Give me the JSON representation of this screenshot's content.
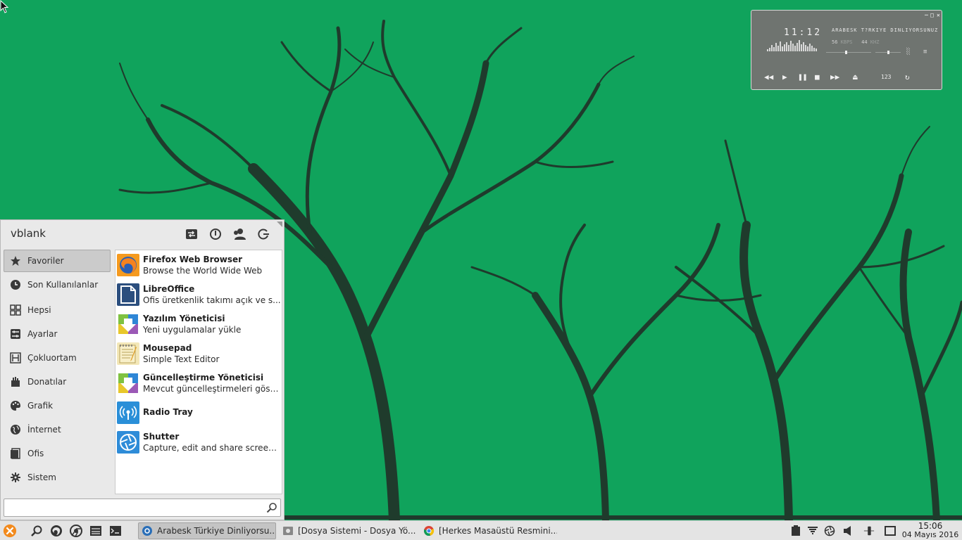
{
  "menu": {
    "username": "vblank",
    "categories": [
      {
        "label": "Favoriler",
        "icon": "star-icon"
      },
      {
        "label": "Son Kullanılanlar",
        "icon": "clock-icon"
      },
      {
        "label": "Hepsi",
        "icon": "grid-icon"
      },
      {
        "label": "Ayarlar",
        "icon": "settings-icon"
      },
      {
        "label": "Çokluortam",
        "icon": "multimedia-icon"
      },
      {
        "label": "Donatılar",
        "icon": "accessories-icon"
      },
      {
        "label": "Grafik",
        "icon": "palette-icon"
      },
      {
        "label": "İnternet",
        "icon": "globe-icon"
      },
      {
        "label": "Ofis",
        "icon": "office-icon"
      },
      {
        "label": "Sistem",
        "icon": "system-icon"
      }
    ],
    "apps": [
      {
        "name": "Firefox Web Browser",
        "desc": "Browse the World Wide Web",
        "icon": "firefox-icon"
      },
      {
        "name": "LibreOffice",
        "desc": "Ofis üretkenlik takımı açık ve s...",
        "icon": "libreoffice-icon"
      },
      {
        "name": "Yazılım Yöneticisi",
        "desc": "Yeni uygulamalar yükle",
        "icon": "software-manager-icon"
      },
      {
        "name": "Mousepad",
        "desc": "Simple Text Editor",
        "icon": "mousepad-icon"
      },
      {
        "name": "Güncelleştirme Yöneticisi",
        "desc": "Mevcut güncelleştirmeleri göst...",
        "icon": "update-manager-icon"
      },
      {
        "name": "Radio Tray",
        "desc": "",
        "icon": "radio-tray-icon"
      },
      {
        "name": "Shutter",
        "desc": "Capture, edit and share screen...",
        "icon": "shutter-icon"
      }
    ],
    "search_value": ""
  },
  "player": {
    "time": "11:12",
    "title": "ARABESK T?RKIYE DINLIYORSUNUZ",
    "kbps_value": "56",
    "kbps_unit": "KBPS",
    "khz_value": "44",
    "khz_unit": "KHZ",
    "counter": "123",
    "seek_fraction": 0.45,
    "volume_fraction": 0.5
  },
  "taskbar": {
    "tasks": [
      {
        "label": "Arabesk Türkiye Dinliyorsu...",
        "icon": "radio-icon",
        "active": true
      },
      {
        "label": "[Dosya Sistemi - Dosya Yö...",
        "icon": "file-manager-icon",
        "active": false
      },
      {
        "label": "[Herkes Masaüstü Resmini...",
        "icon": "chrome-icon",
        "active": false
      }
    ],
    "clock_time": "15:06",
    "clock_date": "04 Mayıs 2016"
  },
  "colors": {
    "wallpaper": "#10a35c",
    "trees": "#1f3b2c",
    "menu_bg": "#e9e9e9",
    "player_bg": "#6f7470"
  }
}
